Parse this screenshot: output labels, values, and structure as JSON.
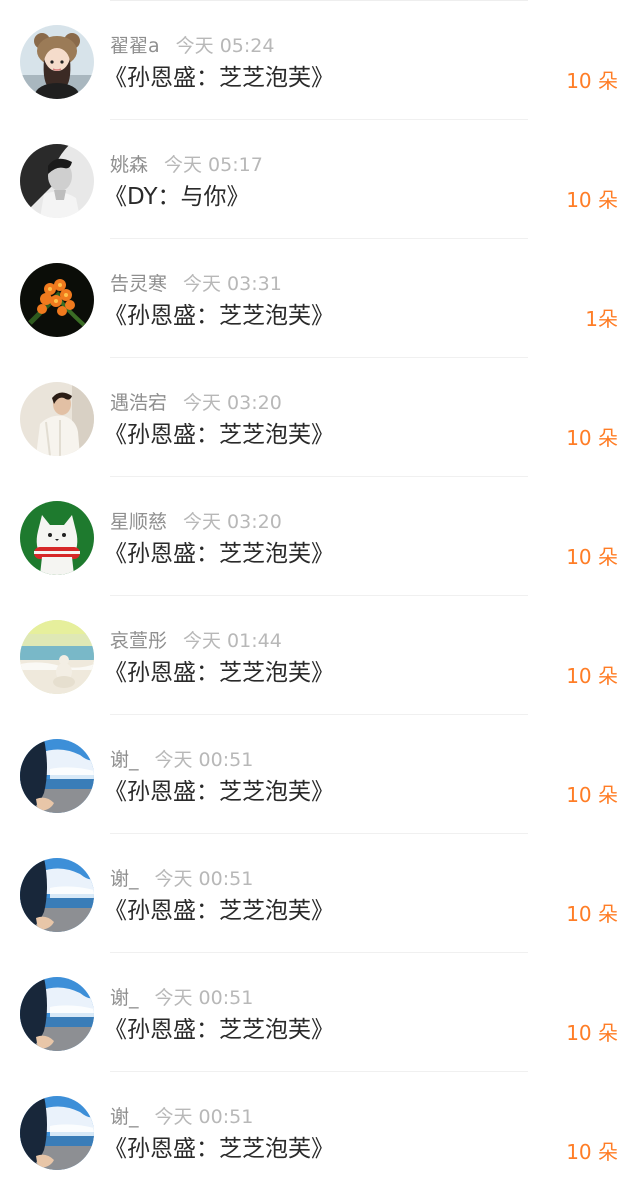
{
  "items": [
    {
      "name": "翟翟a",
      "time": "今天 05:24",
      "song": "《孙恩盛：芝芝泡芙》",
      "gift": "10 朵",
      "avatar": "girl-with-bear-hat-avatar"
    },
    {
      "name": "姚森",
      "time": "今天 05:17",
      "song": "《DY：与你》",
      "gift": "10 朵",
      "avatar": "bw-portrait-avatar"
    },
    {
      "name": "告灵寒",
      "time": "今天 03:31",
      "song": "《孙恩盛：芝芝泡芙》",
      "gift": "1朵",
      "avatar": "orange-flowers-avatar"
    },
    {
      "name": "遇浩宕",
      "time": "今天 03:20",
      "song": "《孙恩盛：芝芝泡芙》",
      "gift": "10 朵",
      "avatar": "man-white-sweater-avatar"
    },
    {
      "name": "星顺慈",
      "time": "今天 03:20",
      "song": "《孙恩盛：芝芝泡芙》",
      "gift": "10 朵",
      "avatar": "white-cat-green-bg-avatar"
    },
    {
      "name": "哀萱彤",
      "time": "今天 01:44",
      "song": "《孙恩盛：芝芝泡芙》",
      "gift": "10 朵",
      "avatar": "beach-snowman-avatar"
    },
    {
      "name": "谢_",
      "time": "今天 00:51",
      "song": "《孙恩盛：芝芝泡芙》",
      "gift": "10 朵",
      "avatar": "sea-sky-avatar"
    },
    {
      "name": "谢_",
      "time": "今天 00:51",
      "song": "《孙恩盛：芝芝泡芙》",
      "gift": "10 朵",
      "avatar": "sea-sky-avatar"
    },
    {
      "name": "谢_",
      "time": "今天 00:51",
      "song": "《孙恩盛：芝芝泡芙》",
      "gift": "10 朵",
      "avatar": "sea-sky-avatar"
    },
    {
      "name": "谢_",
      "time": "今天 00:51",
      "song": "《孙恩盛：芝芝泡芙》",
      "gift": "10 朵",
      "avatar": "sea-sky-avatar"
    }
  ],
  "colors": {
    "gift": "#ff7d26",
    "name": "#8f8f8f",
    "time": "#b8b8b8",
    "song": "#2a2a2a"
  }
}
